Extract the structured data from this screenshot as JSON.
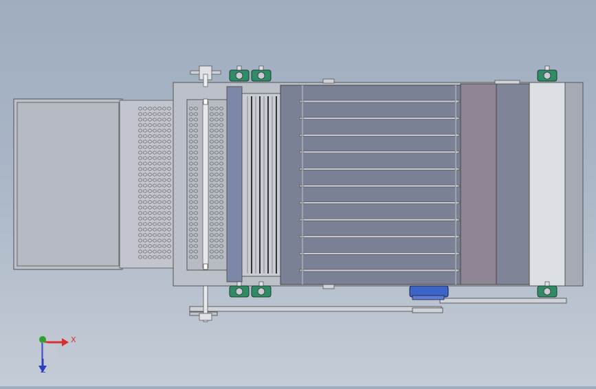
{
  "viewport": {
    "background_top": "#9fadbf",
    "background_bottom": "#c4ccd6",
    "model": "conveyor-dryer-assembly-top-view"
  },
  "triad": {
    "x_label": "X",
    "z_label": "Z",
    "x_color": "#d83030",
    "y_color": "#2ea02e",
    "z_color": "#2b3fbf"
  },
  "colors": {
    "frame": "#c9ccd4",
    "frame_dark": "#9ea3ad",
    "belt": "#7b8195",
    "belt_slat": "#c7cad3",
    "bearing_green": "#2e8c66",
    "motor_blue": "#3a64c8",
    "panel_mauve": "#8f8594",
    "panel_white": "#dcdfe4",
    "roller_blue": "#7d88a8"
  }
}
